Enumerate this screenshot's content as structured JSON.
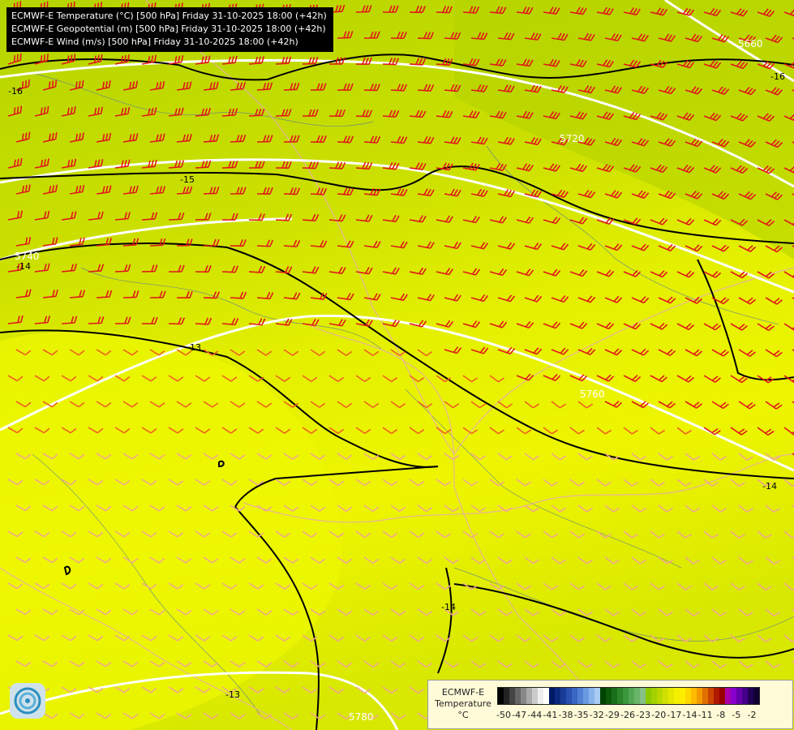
{
  "titles": [
    "ECMWF-E Temperature (°C) [500 hPa] Friday 31-10-2025 18:00 (+42h)",
    "ECMWF-E Geopotential (m) [500 hPa] Friday 31-10-2025 18:00 (+42h)",
    "ECMWF-E Wind (m/s) [500 hPa] Friday 31-10-2025 18:00 (+42h)"
  ],
  "geopotential_labels": [
    "5660",
    "5720",
    "5740",
    "5760",
    "5780"
  ],
  "temperature_labels": [
    "-16",
    "-15",
    "-14",
    "-13",
    "-14",
    "-14",
    "-16",
    "-13"
  ],
  "legend": {
    "line1": "ECMWF-E",
    "line2": "Temperature",
    "line3": "°C",
    "ticks": [
      "-50",
      "-47",
      "-44",
      "-41",
      "-38",
      "-35",
      "-32",
      "-29",
      "-26",
      "-23",
      "-20",
      "-17",
      "-14",
      "-11",
      "-8",
      "-5",
      "-2"
    ],
    "colors": [
      "#000000",
      "#222222",
      "#444444",
      "#666666",
      "#888888",
      "#aaaaaa",
      "#cccccc",
      "#eeeeee",
      "#ffffff",
      "#001a66",
      "#0a2a80",
      "#1a3c99",
      "#2a50b0",
      "#3a66c4",
      "#5080d4",
      "#6a9ae0",
      "#88b4ec",
      "#a8ccf4",
      "#004400",
      "#0a5a0a",
      "#1a701a",
      "#2a842a",
      "#3c963c",
      "#52a852",
      "#6ab46a",
      "#86c086",
      "#8ec800",
      "#a4d000",
      "#bad800",
      "#d0e000",
      "#e4e800",
      "#f4f000",
      "#ffee00",
      "#ffd800",
      "#ffbb00",
      "#f29a00",
      "#e07000",
      "#cc4400",
      "#b01a00",
      "#990000",
      "#aa00aa",
      "#8800cc",
      "#6600aa",
      "#440088",
      "#220055",
      "#110033"
    ]
  }
}
